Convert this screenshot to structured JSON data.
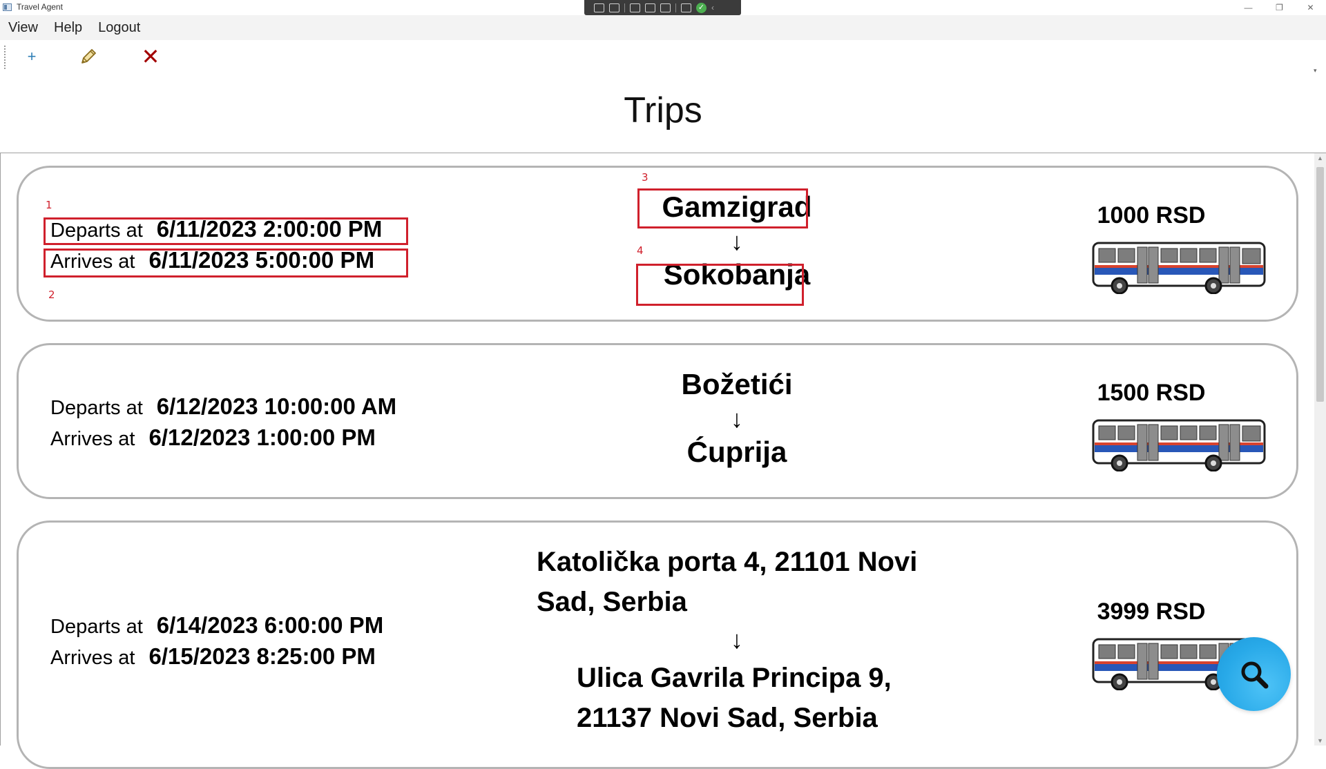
{
  "window": {
    "title": "Travel Agent",
    "controls": {
      "minimize": "—",
      "restore": "❐",
      "close": "✕"
    }
  },
  "menu": {
    "items": [
      "View",
      "Help",
      "Logout"
    ]
  },
  "toolbar": {
    "add_label": "+",
    "add_icon": "plus-icon",
    "edit_icon": "pencil-icon",
    "delete_label": "✕",
    "delete_icon": "close-icon"
  },
  "page": {
    "title": "Trips"
  },
  "labels": {
    "departs": "Departs at",
    "arrives": "Arrives at",
    "arrow": "↓"
  },
  "trips": [
    {
      "departs": "6/11/2023 2:00:00 PM",
      "arrives": "6/11/2023 5:00:00 PM",
      "from": "Gamzigrad",
      "to": "Sokobanja",
      "price": "1000 RSD"
    },
    {
      "departs": "6/12/2023 10:00:00 AM",
      "arrives": "6/12/2023 1:00:00 PM",
      "from": "Božetići",
      "to": "Ćuprija",
      "price": "1500 RSD"
    },
    {
      "departs": "6/14/2023 6:00:00 PM",
      "arrives": "6/15/2023 8:25:00 PM",
      "from": "Katolička porta 4, 21101 Novi Sad, Serbia",
      "to": "Ulica Gavrila Principa 9, 21137 Novi Sad, Serbia",
      "price": "3999 RSD"
    }
  ],
  "annotations": [
    "1",
    "2",
    "3",
    "4"
  ],
  "fab": {
    "icon": "search-icon"
  },
  "colors": {
    "annotation": "#d0202c",
    "fab": "#28a9e8",
    "delete": "#a30000",
    "add": "#2f7fb6"
  }
}
